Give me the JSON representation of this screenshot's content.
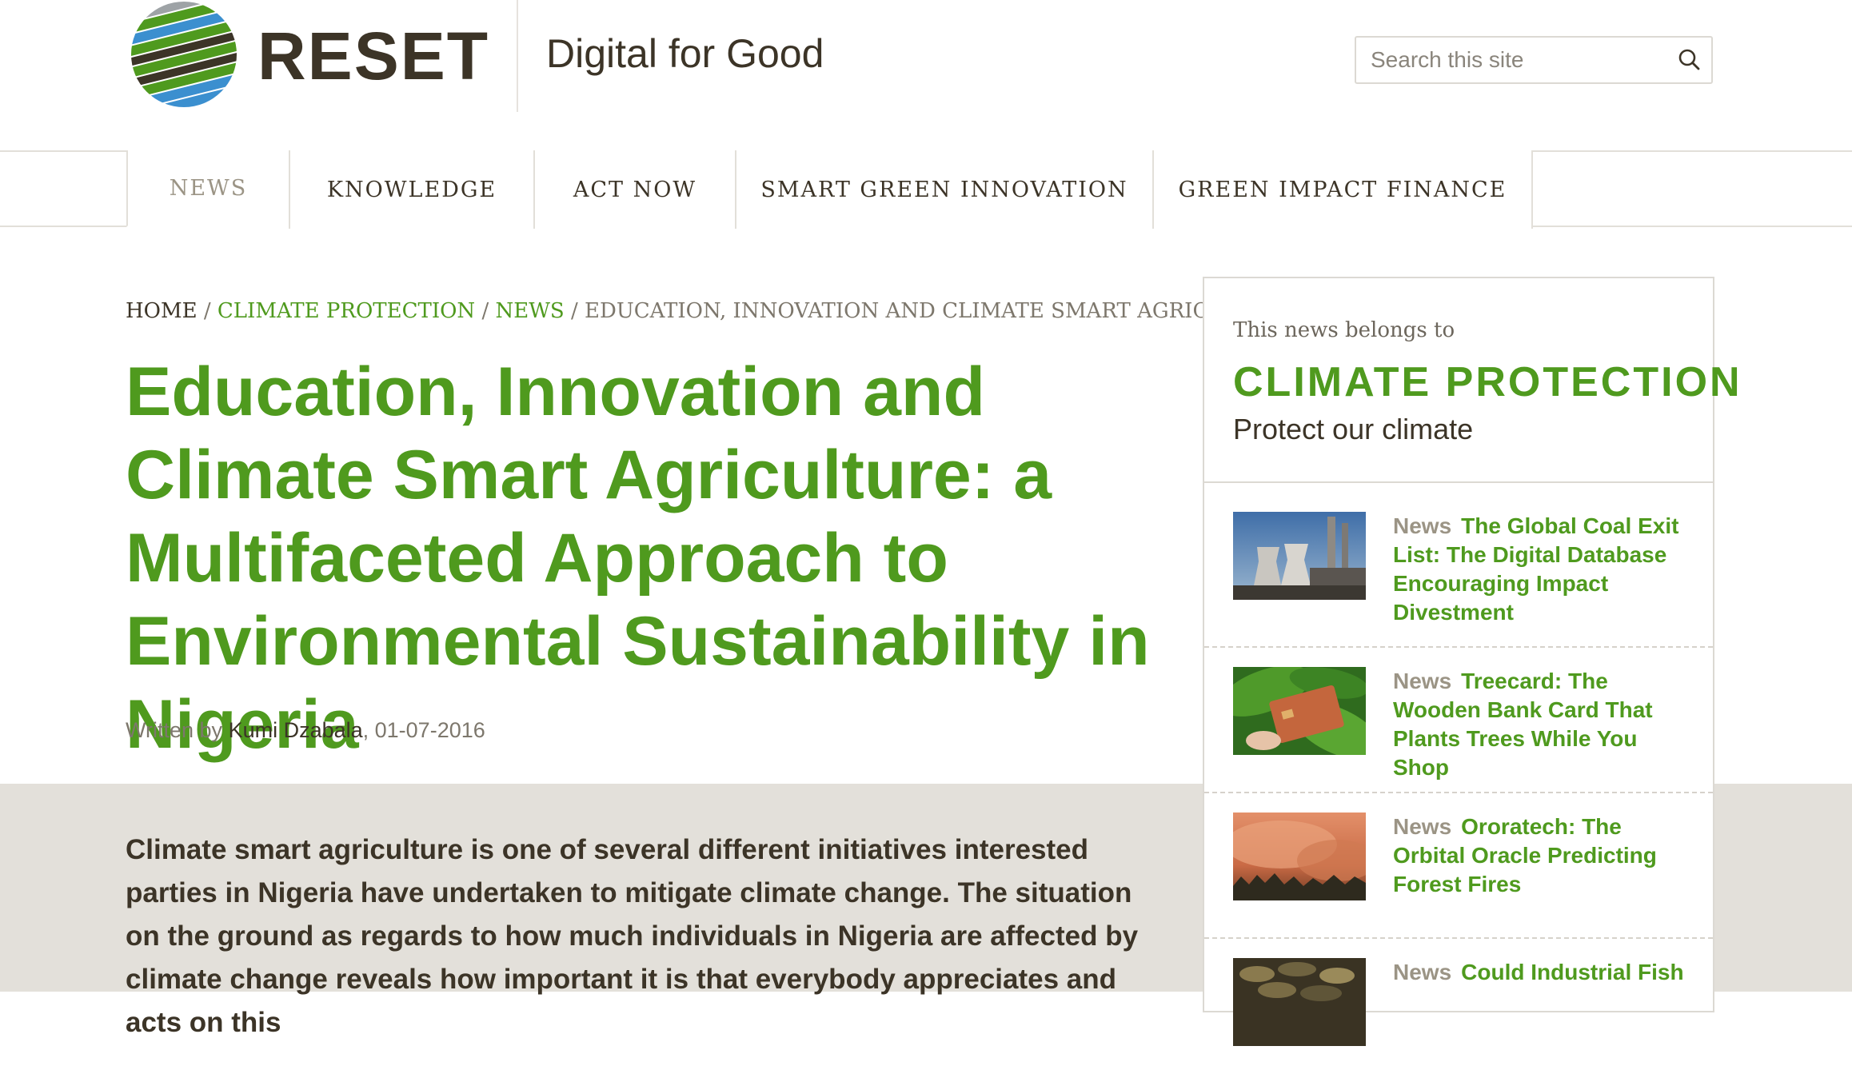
{
  "colors": {
    "accent_green": "#4f9a1e",
    "text_dark": "#3c3427",
    "muted": "#7d776c",
    "band": "#e3e0da"
  },
  "header": {
    "logo_text": "RESET",
    "tagline": "Digital for Good",
    "search": {
      "placeholder": "Search this site",
      "icon": "search-icon"
    }
  },
  "nav": {
    "items": [
      {
        "label": "NEWS",
        "active": true
      },
      {
        "label": "KNOWLEDGE",
        "active": false
      },
      {
        "label": "ACT NOW",
        "active": false
      },
      {
        "label": "SMART GREEN INNOVATION",
        "active": false
      },
      {
        "label": "GREEN IMPACT FINANCE",
        "active": false
      }
    ]
  },
  "breadcrumb": {
    "home": "HOME",
    "separator": "/",
    "category": "CLIMATE PROTECTION",
    "section": "NEWS",
    "current": "EDUCATION, INNOVATION AND CLIMATE SMART AGRICULTURE: ..."
  },
  "article": {
    "title": "Education, Innovation and Climate Smart Agriculture: a Multifaceted Approach to Environmental Sustainability in Nigeria",
    "written_by": "Written by",
    "author": "Kumi Dzabala",
    "date": ", 01-07-2016",
    "lead": "Climate smart agriculture is one of several different initiatives interested parties in Nigeria have undertaken to mitigate climate change. The situation on the ground as regards to how much individuals in Nigeria are affected by climate change reveals how important it is that everybody appreciates and acts on this"
  },
  "sidebar": {
    "kicker": "This news belongs to",
    "category": "CLIMATE PROTECTION",
    "subtitle": "Protect our climate",
    "items": [
      {
        "tag": "News",
        "title": "The Global Coal Exit List: The Digital Database Encouraging Impact Divestment",
        "thumb": "coal-power-plant"
      },
      {
        "tag": "News",
        "title": "Treecard: The Wooden Bank Card That Plants Trees While You Shop",
        "thumb": "wooden-card-on-leaves"
      },
      {
        "tag": "News",
        "title": "Ororatech: The Orbital Oracle Predicting Forest Fires",
        "thumb": "forest-fire-smoke"
      },
      {
        "tag": "News",
        "title": "Could Industrial Fish",
        "thumb": "fish-waste"
      }
    ]
  }
}
